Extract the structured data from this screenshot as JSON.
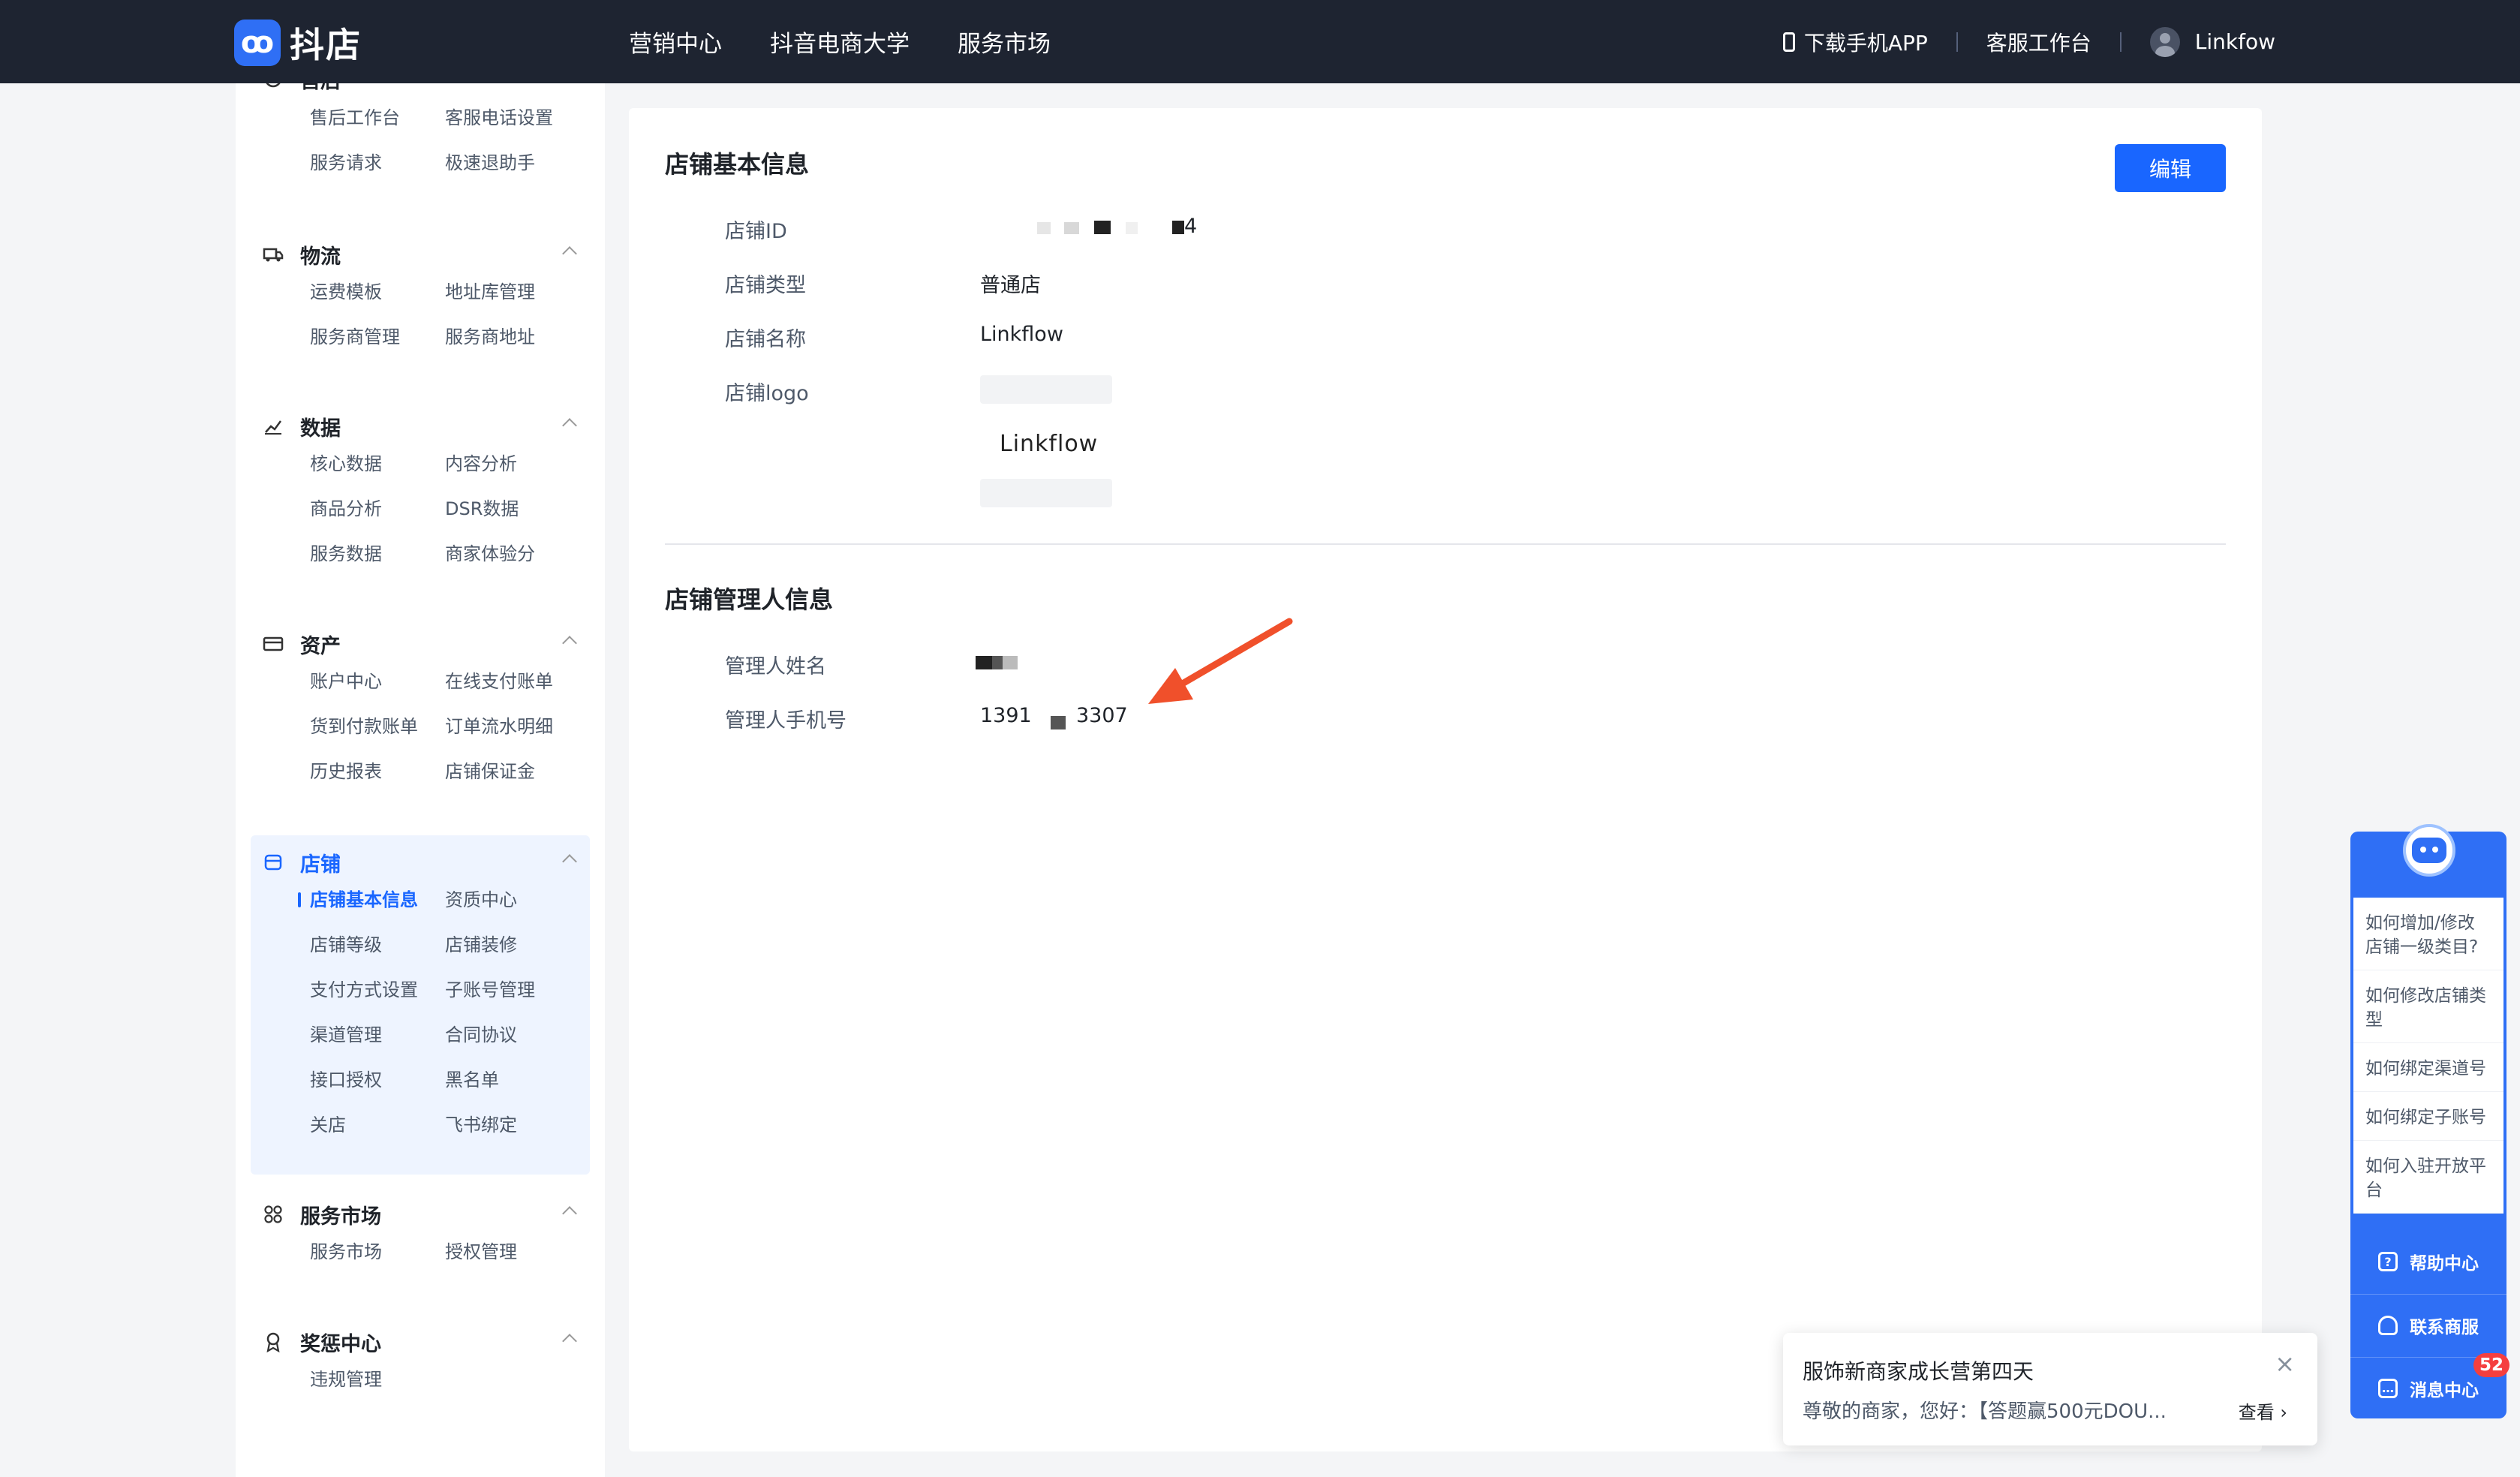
{
  "topbar": {
    "logo_text": "抖店",
    "nav": [
      "营销中心",
      "抖音电商大学",
      "服务市场"
    ],
    "download_app": "下载手机APP",
    "workbench": "客服工作台",
    "username": "Linkfow"
  },
  "sidebar": {
    "sections": [
      {
        "title": "售后",
        "items": [
          "售后工作台",
          "客服电话设置",
          "服务请求",
          "极速退助手"
        ]
      },
      {
        "title": "物流",
        "items": [
          "运费模板",
          "地址库管理",
          "服务商管理",
          "服务商地址"
        ]
      },
      {
        "title": "数据",
        "items": [
          "核心数据",
          "内容分析",
          "商品分析",
          "DSR数据",
          "服务数据",
          "商家体验分"
        ]
      },
      {
        "title": "资产",
        "items": [
          "账户中心",
          "在线支付账单",
          "货到付款账单",
          "订单流水明细",
          "历史报表",
          "店铺保证金"
        ]
      },
      {
        "title": "店铺",
        "items": [
          "店铺基本信息",
          "资质中心",
          "店铺等级",
          "店铺装修",
          "支付方式设置",
          "子账号管理",
          "渠道管理",
          "合同协议",
          "接口授权",
          "黑名单",
          "关店",
          "飞书绑定"
        ]
      },
      {
        "title": "服务市场",
        "items": [
          "服务市场",
          "授权管理"
        ]
      },
      {
        "title": "奖惩中心",
        "items": [
          "违规管理"
        ]
      }
    ]
  },
  "main": {
    "basic_title": "店铺基本信息",
    "edit_label": "编辑",
    "basic_fields": [
      {
        "label": "店铺ID",
        "value": "4"
      },
      {
        "label": "店铺类型",
        "value": "普通店"
      },
      {
        "label": "店铺名称",
        "value": "Linkflow"
      },
      {
        "label": "店铺logo",
        "value": ""
      }
    ],
    "logo_word": "Linkflow",
    "manager_title": "店铺管理人信息",
    "manager_fields": [
      {
        "label": "管理人姓名",
        "value": ""
      },
      {
        "label": "管理人手机号",
        "value_prefix": "1391",
        "value_suffix": "3307"
      }
    ]
  },
  "help": {
    "questions": [
      "如何增加/修改店铺一级类目?",
      "如何修改店铺类型",
      "如何绑定渠道号",
      "如何绑定子账号",
      "如何入驻开放平台"
    ],
    "buttons": [
      "帮助中心",
      "联系商服",
      "消息中心"
    ],
    "message_badge": "52"
  },
  "notification": {
    "title": "服饰新商家成长营第四天",
    "body": "尊敬的商家，您好：【答题赢500元DOU...",
    "action": "查看 ›",
    "close": "×"
  },
  "colors": {
    "accent": "#1966ff",
    "topbar": "#1e2431",
    "arrow": "#f0502b"
  }
}
